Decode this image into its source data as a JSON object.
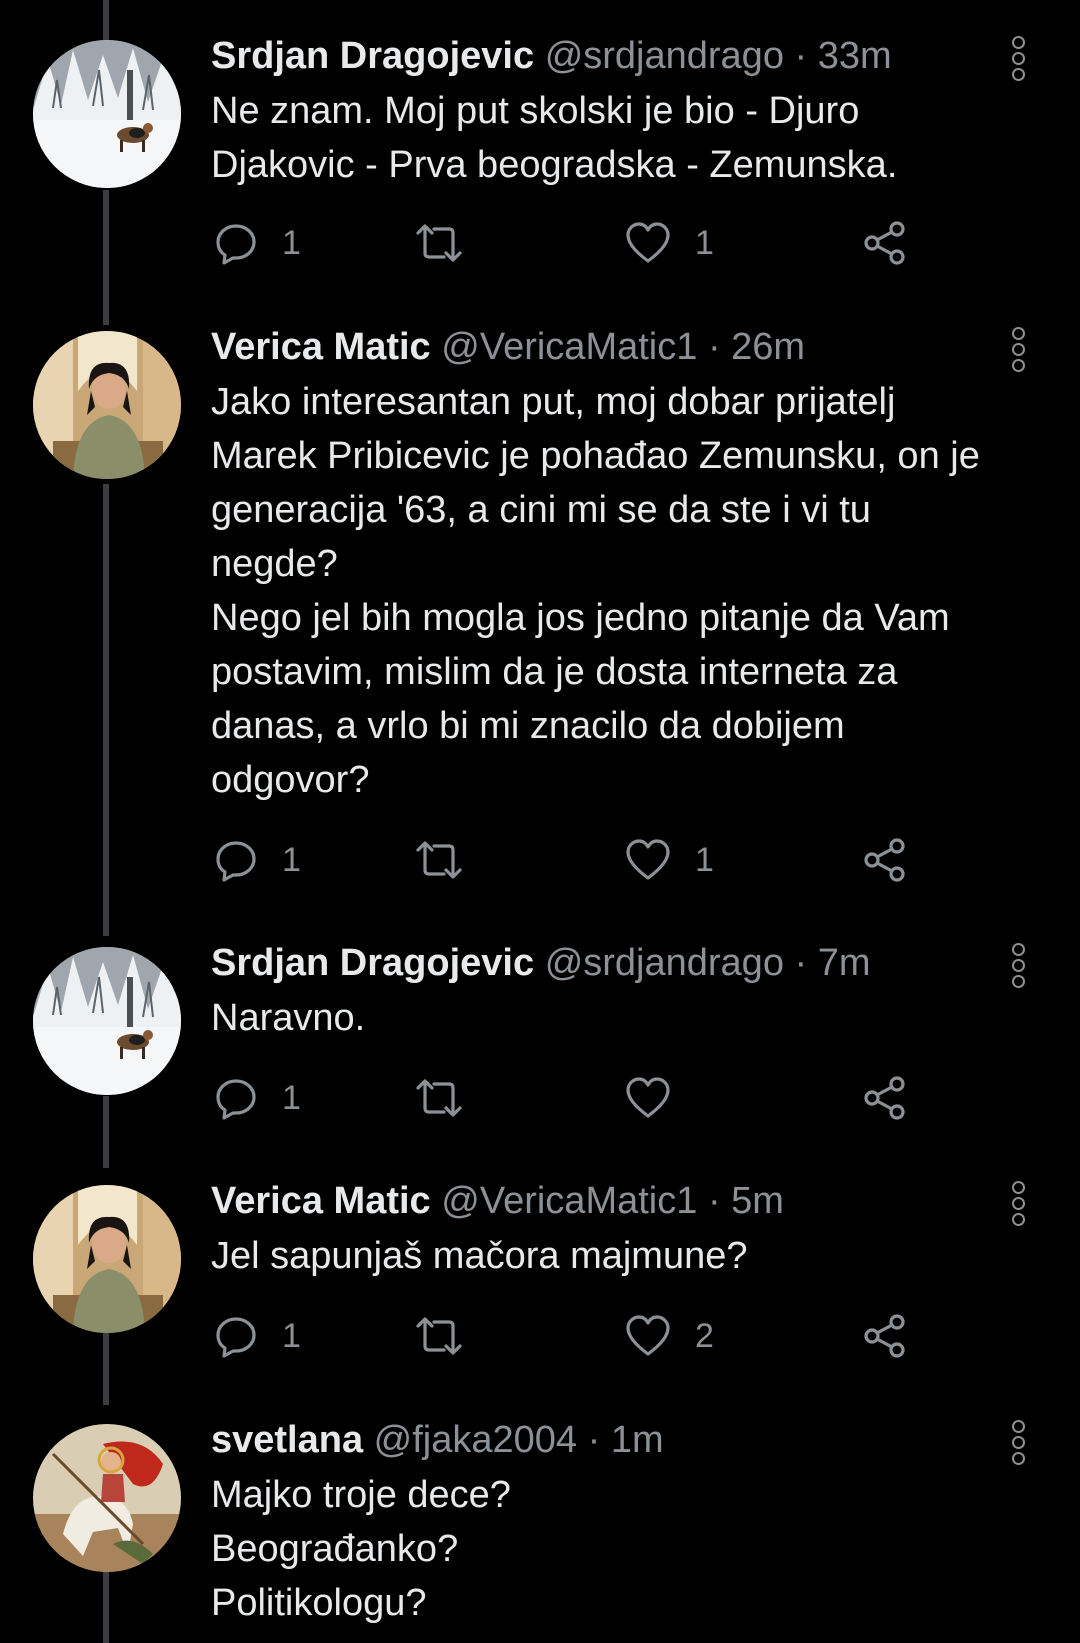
{
  "tweets": [
    {
      "name": "Srdjan Dragojevic",
      "handle": "@srdjandrago",
      "time": "33m",
      "avatar": "snow-dog-avatar",
      "text": "Ne znam. Moj put skolski je bio - Djuro\nDjakovic - Prva beogradska - Zemunska.",
      "replies": "1",
      "retweets": "",
      "likes": "1"
    },
    {
      "name": "Verica Matic",
      "handle": "@VericaMatic1",
      "time": "26m",
      "avatar": "woman-portrait-avatar",
      "text": "Jako interesantan put, moj dobar prijatelj\nMarek Pribicevic je pohađao Zemunsku, on je\ngeneracija '63, a cini mi se da ste i vi tu\nnegde?\nNego jel bih mogla jos jedno pitanje da Vam\npostavim, mislim da je dosta interneta za\ndanas, a vrlo bi mi znacilo da dobijem\nodgovor?",
      "replies": "1",
      "retweets": "",
      "likes": "1"
    },
    {
      "name": "Srdjan Dragojevic",
      "handle": "@srdjandrago",
      "time": "7m",
      "avatar": "snow-dog-avatar",
      "text": "Naravno.",
      "replies": "1",
      "retweets": "",
      "likes": ""
    },
    {
      "name": "Verica Matic",
      "handle": "@VericaMatic1",
      "time": "5m",
      "avatar": "woman-portrait-avatar",
      "text": "Jel sapunjaš mačora majmune?",
      "replies": "1",
      "retweets": "",
      "likes": "2"
    },
    {
      "name": "svetlana",
      "handle": "@fjaka2004",
      "time": "1m",
      "avatar": "saint-george-painting-avatar",
      "text": "Majko troje dece?\nBeograđanko?\nPolitikologu?",
      "replies": "",
      "retweets": "",
      "likes": ""
    }
  ],
  "icons": {
    "reply": "reply-icon",
    "retweet": "retweet-icon",
    "like": "heart-icon",
    "share": "share-icon",
    "more": "more-options-icon"
  },
  "colors": {
    "background": "#000000",
    "text": "#e7e9ea",
    "muted": "#8b9196",
    "thread_line": "#3a3e42"
  }
}
